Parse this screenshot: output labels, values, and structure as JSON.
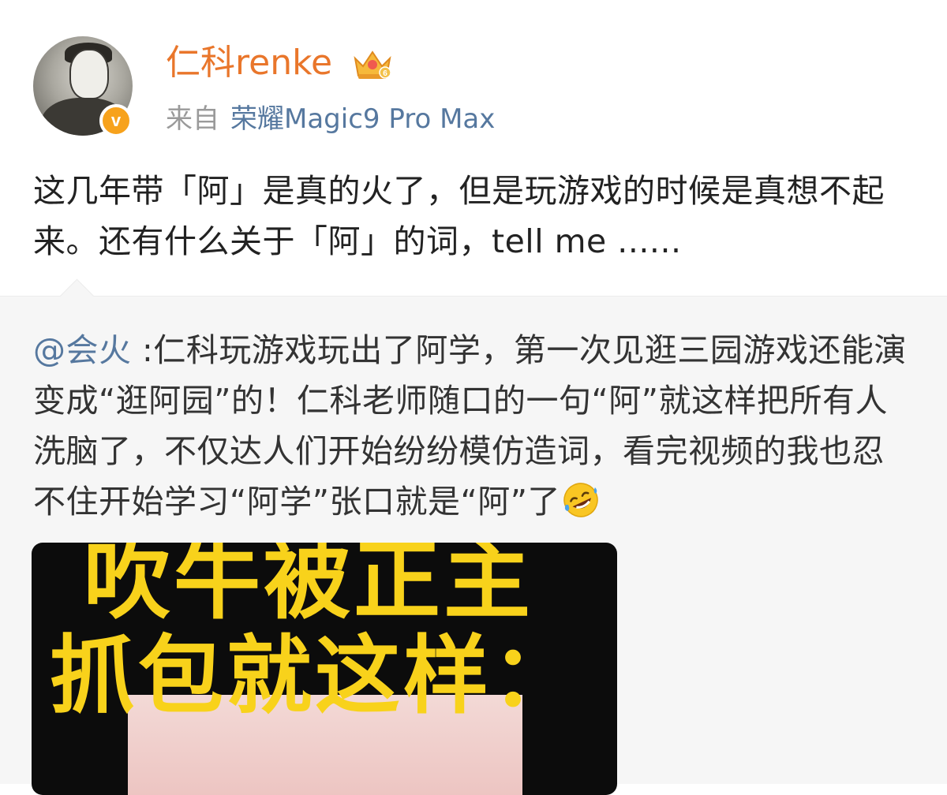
{
  "post": {
    "author": "仁科renke",
    "source_prefix": "来自",
    "source_device": "荣耀Magic9 Pro Max",
    "text": "这几年带「阿」是真的火了，但是玩游戏的时候是真想不起来。还有什么关于「阿」的词，tell me ......",
    "badge_level": "6"
  },
  "repost": {
    "mention": "@会火",
    "text": " :仁科玩游戏玩出了阿学，第一次见逛三园游戏还能演变成“逛阿园”的！仁科老师随口的一句“阿”就这样把所有人洗脑了，不仅达人们开始纷纷模仿造词，看完视频的我也忍不住开始学习“阿学”张口就是“阿”了",
    "video": {
      "caption_line1": "吹牛被正主",
      "caption_line2": "抓包就这样："
    }
  },
  "colors": {
    "username": "#e9762b",
    "link": "#56789f",
    "verified_badge": "#f7a21c",
    "caption": "#f8d21b"
  },
  "icons": {
    "verified": "verified-v-icon",
    "membership": "crown-icon",
    "emoji": "rolling-laughing-emoji"
  }
}
